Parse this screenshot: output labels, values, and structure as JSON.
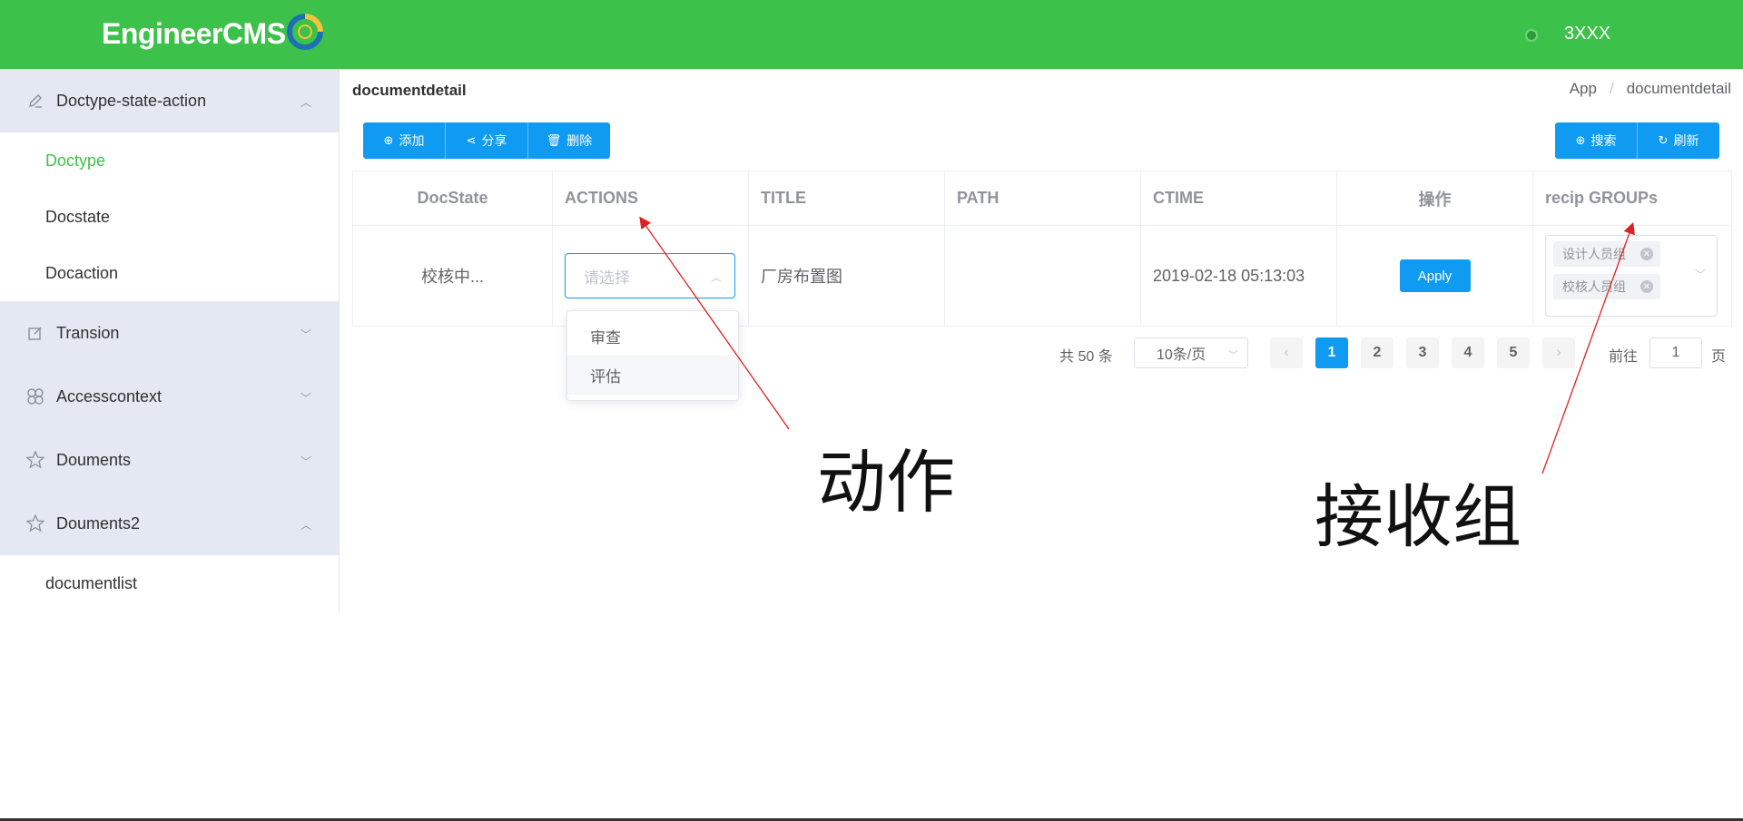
{
  "header": {
    "logo_text": "EngineerCMS",
    "user_name": "3XXX"
  },
  "sidebar": {
    "groups": [
      {
        "label": "Doctype-state-action",
        "expanded": true,
        "icon": "edit-pen-icon"
      },
      {
        "label": "Transion",
        "expanded": false,
        "icon": "edit-box-icon"
      },
      {
        "label": "Accesscontext",
        "expanded": false,
        "icon": "grid-icon"
      },
      {
        "label": "Douments",
        "expanded": false,
        "icon": "star-icon"
      },
      {
        "label": "Douments2",
        "expanded": true,
        "icon": "star-icon"
      }
    ],
    "sub_items": [
      {
        "label": "Doctype",
        "active": true
      },
      {
        "label": "Docstate"
      },
      {
        "label": "Docaction"
      },
      {
        "label": "documentlist"
      }
    ]
  },
  "page": {
    "title": "documentdetail",
    "breadcrumb": [
      "App",
      "documentdetail"
    ]
  },
  "toolbar": {
    "left_buttons": [
      {
        "label": "添加",
        "icon": "plus-circle-icon"
      },
      {
        "label": "分享",
        "icon": "share-icon"
      },
      {
        "label": "删除",
        "icon": "trash-icon"
      }
    ],
    "right_buttons": [
      {
        "label": "搜索",
        "icon": "plus-circle-icon"
      },
      {
        "label": "刷新",
        "icon": "refresh-icon"
      }
    ]
  },
  "table": {
    "headers": [
      "DocState",
      "ACTIONS",
      "TITLE",
      "PATH",
      "CTIME",
      "操作",
      "recip GROUPs"
    ],
    "row": {
      "docstate": "校核中...",
      "actions_placeholder": "请选择",
      "title": "厂房布置图",
      "path": "",
      "ctime": "2019-02-18 05:13:03",
      "apply_label": "Apply",
      "groups": [
        "设计人员组",
        "校核人员组"
      ]
    }
  },
  "dropdown": {
    "options": [
      "审查",
      "评估"
    ],
    "hovered_index": 1
  },
  "pagination": {
    "total_text": "共 50 条",
    "page_size": "10条/页",
    "pages": [
      "1",
      "2",
      "3",
      "4",
      "5"
    ],
    "current_page": 1,
    "goto_label": "前往",
    "goto_value": "1",
    "page_suffix": "页"
  },
  "annotations": {
    "actions_note": "动作",
    "groups_note": "接收组",
    "arrow_color": "#e02020"
  },
  "colors": {
    "header_bg": "#3cc24a",
    "primary": "#0f9bf2",
    "sidebar_group_bg": "#e4e8f2",
    "active_text": "#3cc24a"
  }
}
